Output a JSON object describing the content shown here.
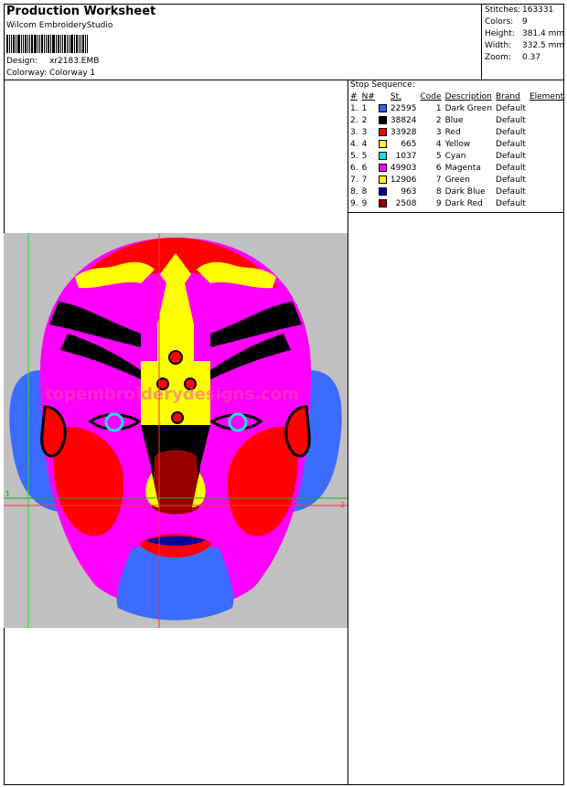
{
  "header": {
    "title": "Production Worksheet",
    "software": "Wilcom EmbroideryStudio",
    "design_label": "Design:",
    "design_value": "xr2183.EMB",
    "colorway_label": "Colorway:",
    "colorway_value": "Colorway 1"
  },
  "stats": [
    {
      "label": "Stitches:",
      "value": "163331"
    },
    {
      "label": "Colors:",
      "value": "9"
    },
    {
      "label": "Height:",
      "value": "381.4 mm"
    },
    {
      "label": "Width:",
      "value": "332.5 mm"
    },
    {
      "label": "Zoom:",
      "value": "0.37"
    }
  ],
  "stop_sequence": {
    "title": "Stop Sequence:",
    "columns": [
      "#",
      "N#",
      "St.",
      "Code",
      "Description",
      "Brand",
      "Element"
    ],
    "rows": [
      {
        "num": "1.",
        "n": "1",
        "color": "#3366ff",
        "st": "22595",
        "code": "1",
        "desc": "Dark Green",
        "brand": "Default"
      },
      {
        "num": "2.",
        "n": "2",
        "color": "#000000",
        "st": "38824",
        "code": "2",
        "desc": "Blue",
        "brand": "Default"
      },
      {
        "num": "3.",
        "n": "3",
        "color": "#ff0000",
        "st": "33928",
        "code": "3",
        "desc": "Red",
        "brand": "Default"
      },
      {
        "num": "4.",
        "n": "4",
        "color": "#ffff00",
        "st": "665",
        "code": "4",
        "desc": "Yellow",
        "brand": "Default"
      },
      {
        "num": "5.",
        "n": "5",
        "color": "#00e5e5",
        "st": "1037",
        "code": "5",
        "desc": "Cyan",
        "brand": "Default"
      },
      {
        "num": "6.",
        "n": "6",
        "color": "#ff00ff",
        "st": "49903",
        "code": "6",
        "desc": "Magenta",
        "brand": "Default"
      },
      {
        "num": "7.",
        "n": "7",
        "color": "#ffff00",
        "st": "12906",
        "code": "7",
        "desc": "Green",
        "brand": "Default"
      },
      {
        "num": "8.",
        "n": "8",
        "color": "#000099",
        "st": "963",
        "code": "8",
        "desc": "Dark Blue",
        "brand": "Default"
      },
      {
        "num": "9.",
        "n": "9",
        "color": "#990000",
        "st": "2508",
        "code": "9",
        "desc": "Dark Red",
        "brand": "Default"
      }
    ]
  },
  "design_view": {
    "background": "#c0c0c0",
    "guide_color_h": "#22aa22",
    "guide_color_v": "#22dd22",
    "marker_left": "1",
    "marker_right": "2",
    "watermark": "topembroiderydesigns.com"
  }
}
